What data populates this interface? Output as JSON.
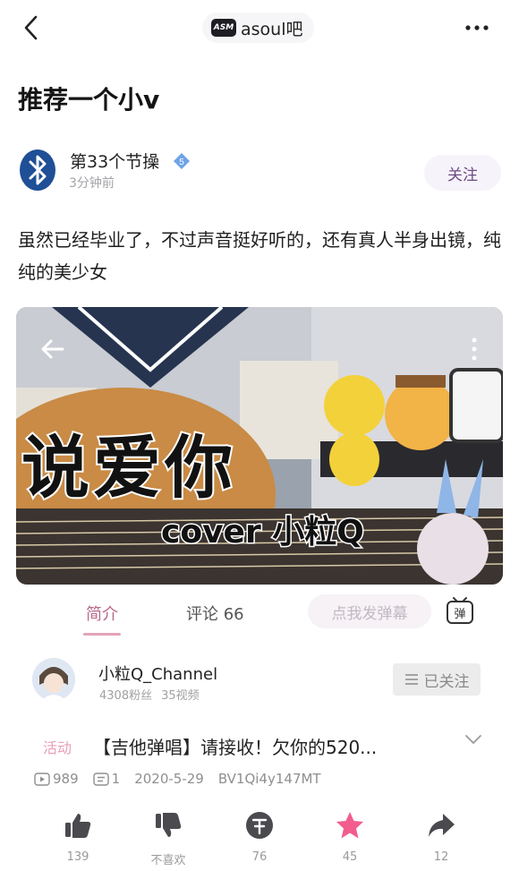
{
  "header": {
    "forum_logo_text": "ASM",
    "forum_name": "asoul吧"
  },
  "post": {
    "title": "推荐一个小v",
    "author": "第33个节操",
    "level": "5",
    "time": "3分钟前",
    "follow_label": "关注",
    "body": "虽然已经毕业了，不过声音挺好听的，还有真人半身出镜，纯纯的美少女"
  },
  "video": {
    "overlay_title": "说爱你",
    "overlay_subtitle": "cover 小粒Q"
  },
  "tabs": {
    "intro": "简介",
    "comments": "评论 66",
    "danmaku_placeholder": "点我发弹幕",
    "danmaku_icon_text": "弹"
  },
  "uploader": {
    "name": "小粒Q_Channel",
    "fans": "4308粉丝",
    "videos": "35视频",
    "follow_state": "已关注"
  },
  "video_info": {
    "tag": "活动",
    "title": "【吉他弹唱】请接收！欠你的520...",
    "plays": "989",
    "danmaku_count": "1",
    "date": "2020-5-29",
    "bvid": "BV1Qi4y147MT"
  },
  "actions": {
    "like": "139",
    "dislike": "不喜欢",
    "coin": "76",
    "favorite": "45",
    "share": "12"
  },
  "colors": {
    "accent_pink": "#e4a3bb",
    "favorite_pink": "#f25d8e",
    "icon_dark": "#4a4a4f"
  }
}
